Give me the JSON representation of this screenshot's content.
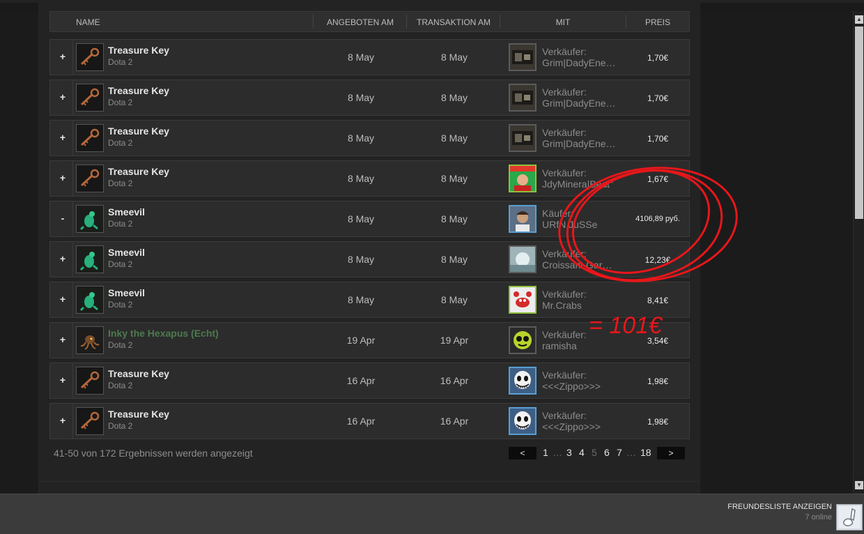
{
  "header": {
    "name": "NAME",
    "offered": "ANGEBOTEN AM",
    "transaction": "TRANSAKTION AM",
    "with": "MIT",
    "price": "PREIS"
  },
  "rows": [
    {
      "toggle": "+",
      "item": "Treasure Key",
      "game": "Dota 2",
      "offered": "8 May",
      "transaction": "8 May",
      "role": "Verkäufer:",
      "user": "Grim|DadyEne…",
      "price": "1,70€",
      "icon": "key-icon",
      "avatar": "dark-scene-avatar"
    },
    {
      "toggle": "+",
      "item": "Treasure Key",
      "game": "Dota 2",
      "offered": "8 May",
      "transaction": "8 May",
      "role": "Verkäufer:",
      "user": "Grim|DadyEne…",
      "price": "1,70€",
      "icon": "key-icon",
      "avatar": "dark-scene-avatar"
    },
    {
      "toggle": "+",
      "item": "Treasure Key",
      "game": "Dota 2",
      "offered": "8 May",
      "transaction": "8 May",
      "role": "Verkäufer:",
      "user": "Grim|DadyEne…",
      "price": "1,70€",
      "icon": "key-icon",
      "avatar": "dark-scene-avatar"
    },
    {
      "toggle": "+",
      "item": "Treasure Key",
      "game": "Dota 2",
      "offered": "8 May",
      "transaction": "8 May",
      "role": "Verkäufer:",
      "user": "JdyMinera|Beat\"",
      "price": "1,67€",
      "icon": "key-icon",
      "avatar": "colorful-avatar"
    },
    {
      "toggle": "-",
      "item": "Smeevil",
      "game": "Dota 2",
      "offered": "8 May",
      "transaction": "8 May",
      "role": "Käufer:",
      "user": "URfN JuSSe",
      "price": "4106,89 руб.",
      "icon": "smeevil-icon",
      "avatar": "portrait-avatar"
    },
    {
      "toggle": "+",
      "item": "Smeevil",
      "game": "Dota 2",
      "offered": "8 May",
      "transaction": "8 May",
      "role": "Verkäufer:",
      "user": "Croissant Gar…",
      "price": "12,23€",
      "icon": "smeevil-icon",
      "avatar": "pale-avatar"
    },
    {
      "toggle": "+",
      "item": "Smeevil",
      "game": "Dota 2",
      "offered": "8 May",
      "transaction": "8 May",
      "role": "Verkäufer:",
      "user": "Mr.Crabs",
      "price": "8,41€",
      "icon": "smeevil-icon",
      "avatar": "crab-avatar"
    },
    {
      "toggle": "+",
      "item": "Inky the Hexapus (Echt)",
      "game": "Dota 2",
      "offered": "19 Apr",
      "transaction": "19 Apr",
      "role": "Verkäufer:",
      "user": "ramisha",
      "price": "3,54€",
      "icon": "hexapus-icon",
      "avatar": "alien-avatar"
    },
    {
      "toggle": "+",
      "item": "Treasure Key",
      "game": "Dota 2",
      "offered": "16 Apr",
      "transaction": "16 Apr",
      "role": "Verkäufer:",
      "user": "<<<Zippo>>>",
      "price": "1,98€",
      "icon": "key-icon",
      "avatar": "skull-avatar"
    },
    {
      "toggle": "+",
      "item": "Treasure Key",
      "game": "Dota 2",
      "offered": "16 Apr",
      "transaction": "16 Apr",
      "role": "Verkäufer:",
      "user": "<<<Zippo>>>",
      "price": "1,98€",
      "icon": "key-icon",
      "avatar": "skull-avatar"
    }
  ],
  "results_text": "41-50 von 172 Ergebnissen werden angezeigt",
  "pagination": {
    "prev": "<",
    "next": ">",
    "pages": [
      "1",
      "…",
      "3",
      "4",
      "5",
      "6",
      "7",
      "…",
      "18"
    ],
    "current": "5"
  },
  "friends": {
    "label": "FREUNDESLISTE ANZEIGEN",
    "online": "7 online"
  },
  "annotation": {
    "text": "= 101€",
    "color": "#e8161a"
  }
}
